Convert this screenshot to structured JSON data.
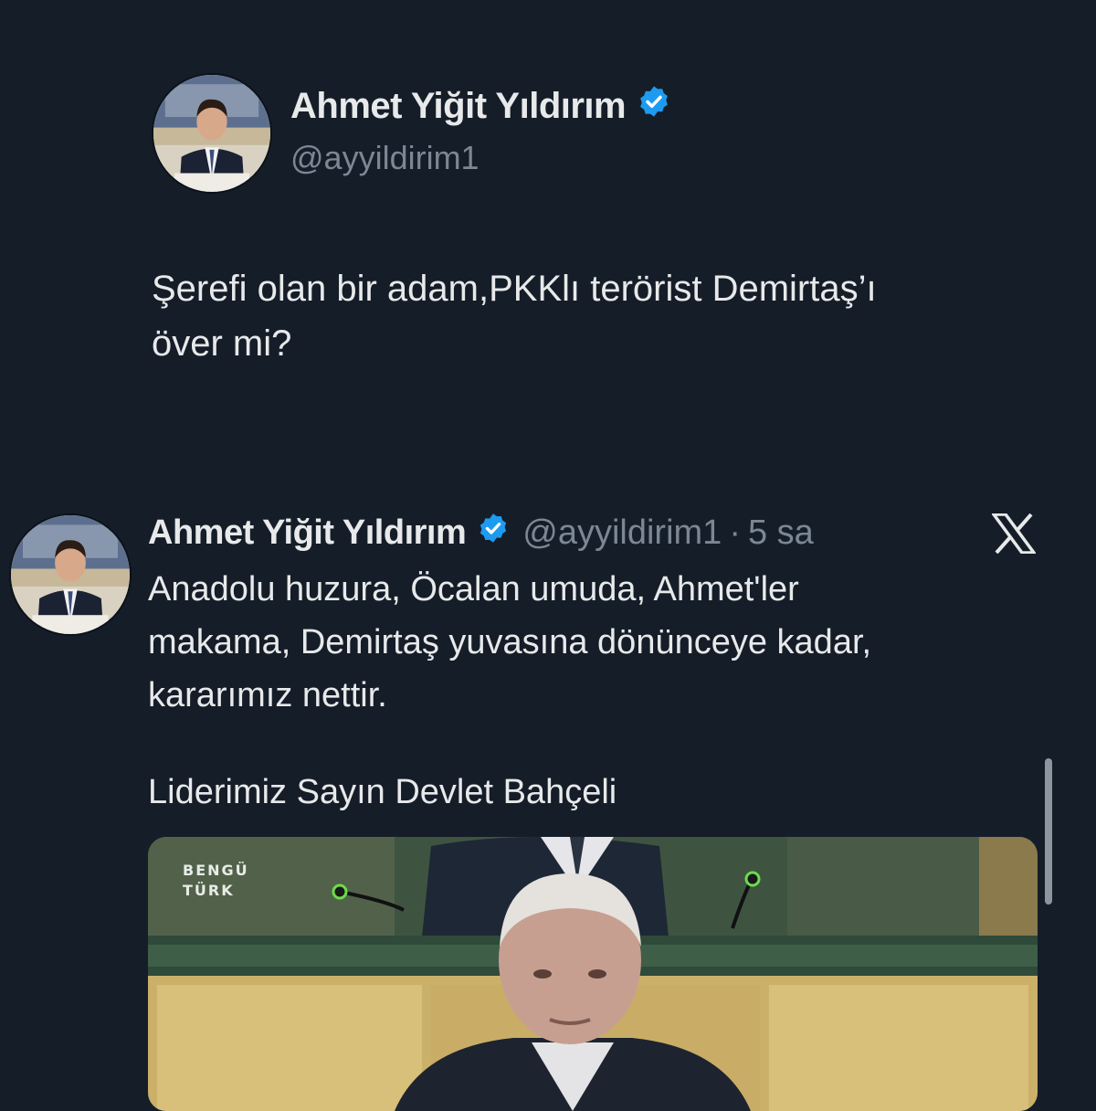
{
  "post": {
    "author_name": "Ahmet Yiğit Yıldırım",
    "author_handle": "@ayyildirim1",
    "verified_icon": "verified-badge-icon",
    "text_line1": "Şerefi olan bir adam,PKKlı terörist Demirtaş’ı",
    "text_line2": "över mi?"
  },
  "quoted_post": {
    "author_name": "Ahmet Yiğit Yıldırım",
    "author_handle": "@ayyildirim1",
    "separator": "·",
    "time": "5 sa",
    "source_icon": "x-logo-icon",
    "text_line1": "Anadolu huzura, Öcalan umuda, Ahmet'ler",
    "text_line2": "makama, Demirtaş yuvasına dönünceye kadar,",
    "text_line3": "kararımız nettir.",
    "text_line4": "Liderimiz Sayın Devlet Bahçeli",
    "media": {
      "channel_logo_line1": "BENGÜ",
      "channel_logo_line2": "TÜRK"
    }
  },
  "colors": {
    "background": "#151d28",
    "text_primary": "#e7e9ea",
    "text_secondary": "#7b8794",
    "verified": "#1d9bf0"
  }
}
